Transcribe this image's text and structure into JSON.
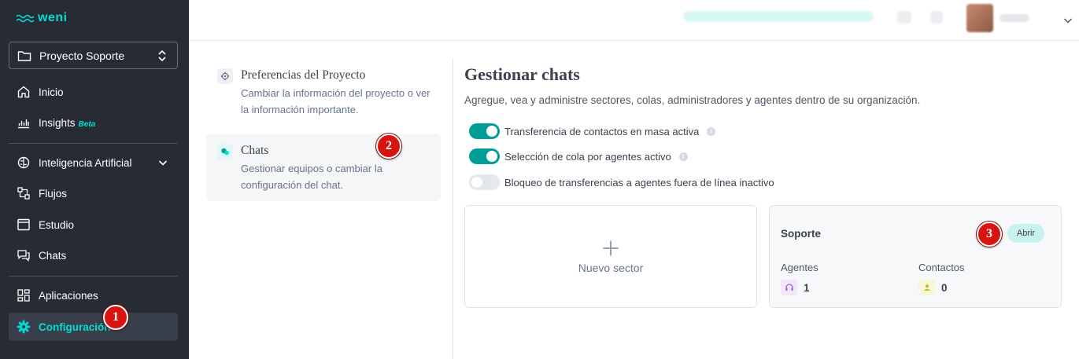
{
  "brand": {
    "logo_text": "weni",
    "logo_color": "#00ded3"
  },
  "sidebar": {
    "project": {
      "name": "Proyecto Soporte"
    },
    "items": [
      {
        "label": "Inicio",
        "icon": "home-icon"
      },
      {
        "label": "Insights",
        "badge": "Beta",
        "icon": "chart-icon"
      },
      {
        "label": "Inteligencia Artificial",
        "icon": "brain-icon"
      },
      {
        "label": "Flujos",
        "icon": "flow-icon"
      },
      {
        "label": "Estudio",
        "icon": "window-icon"
      },
      {
        "label": "Chats",
        "icon": "chat-icon"
      },
      {
        "label": "Aplicaciones",
        "icon": "apps-icon"
      },
      {
        "label": "Configuración",
        "icon": "gear-icon",
        "active": true
      }
    ]
  },
  "settings_menu": [
    {
      "title": "Preferencias del Proyecto",
      "description": "Cambiar la información del proyecto o ver la información importante."
    },
    {
      "title": "Chats",
      "description": "Gestionar equipos o cambiar la configuración del chat.",
      "selected": true
    }
  ],
  "main": {
    "title": "Gestionar chats",
    "subtitle": "Agregue, vea y administre sectores, colas, administradores y agentes dentro de su organización.",
    "toggles": [
      {
        "label": "Transferencia de contactos en masa activa",
        "on": true,
        "info": true
      },
      {
        "label": "Selección de cola por agentes activo",
        "on": true,
        "info": true
      },
      {
        "label": "Bloqueo de transferencias a agentes fuera de línea inactivo",
        "on": false,
        "info": false
      }
    ],
    "new_sector": {
      "plus": "+",
      "label": "Nuevo sector"
    },
    "sector": {
      "name": "Soporte",
      "open_label": "Abrir",
      "agents_label": "Agentes",
      "agents_value": "1",
      "contacts_label": "Contactos",
      "contacts_value": "0"
    }
  },
  "markers": [
    "1",
    "2",
    "3"
  ],
  "colors": {
    "accent": "#00ded3",
    "switch_on": "#009e96",
    "marker": "#d81410",
    "sidebar_bg": "#272b33"
  }
}
